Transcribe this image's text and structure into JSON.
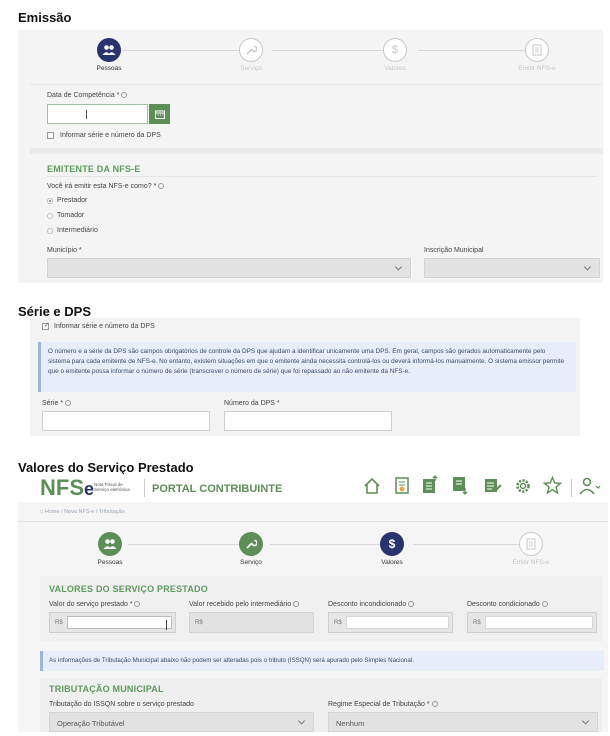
{
  "sections": {
    "emissao_title": "Emissão",
    "serie_title": "Série e DPS",
    "valores_title": "Valores do Serviço Prestado"
  },
  "stepper1": [
    "Pessoas",
    "Serviço",
    "Valores",
    "Emitir NFS-e"
  ],
  "emissao": {
    "data_label": "Data de Competência *",
    "informar_serie": "Informar série e número da DPS",
    "emitente_heading": "EMITENTE DA NFS-E",
    "como_label": "Você irá emitir esta NFS-e como? *",
    "options": [
      "Prestador",
      "Tomador",
      "Intermediário"
    ],
    "municipio_label": "Município *",
    "inscricao_label": "Inscrição Municipal"
  },
  "serie": {
    "checkbox_label": "Informar série e número da DPS",
    "info_text": "O número e a série da DPS são campos obrigatórios de controle da DPS que ajudam a identificar unicamente uma DPS. Em geral, campos são gerados automaticamente pelo sistema para cada emitente de NFS-e. No entanto, existem situações em que o emitente ainda necessita controlá-los ou deverá informá-los manualmente. O sistema emissor permite que o emitente possa informar o número de série (transcrever o número de série) que foi repassado ao não emitente da NFS-e.",
    "serie_label": "Série *",
    "numero_label": "Número da DPS *"
  },
  "portal": {
    "logo_nfs": "NFS",
    "logo_e": "e",
    "logo_sub1": "Nota Fiscal de",
    "logo_sub2": "Serviço eletrônica",
    "title": "PORTAL CONTRIBUINTE",
    "breadcrumb": [
      "Home",
      "Nova NFS-e",
      "Tributação"
    ]
  },
  "stepper2": [
    "Pessoas",
    "Serviço",
    "Valores",
    "Emitir NFS-e"
  ],
  "valores": {
    "heading": "VALORES DO SERVIÇO PRESTADO",
    "fields": [
      "Valor do serviço prestado *",
      "Valor recebido pelo intermediário",
      "Desconto incondicionado",
      "Desconto condicionado"
    ],
    "currency": "R$",
    "info_bar": "As informações de Tributação Municipal abaixo não podem ser alteradas pois o tributo (ISSQN) será apurado pelo Simples Nacional.",
    "trib_heading": "TRIBUTAÇÃO MUNICIPAL",
    "trib_label": "Tributação do ISSQN sobre o serviço prestado",
    "trib_value": "Operação Tributável",
    "regime_label": "Regime Especial de Tributação *",
    "regime_value": "Nenhum"
  },
  "colors": {
    "green": "#5c8f55",
    "navy": "#27346e",
    "info_bg": "#e7eefa"
  }
}
